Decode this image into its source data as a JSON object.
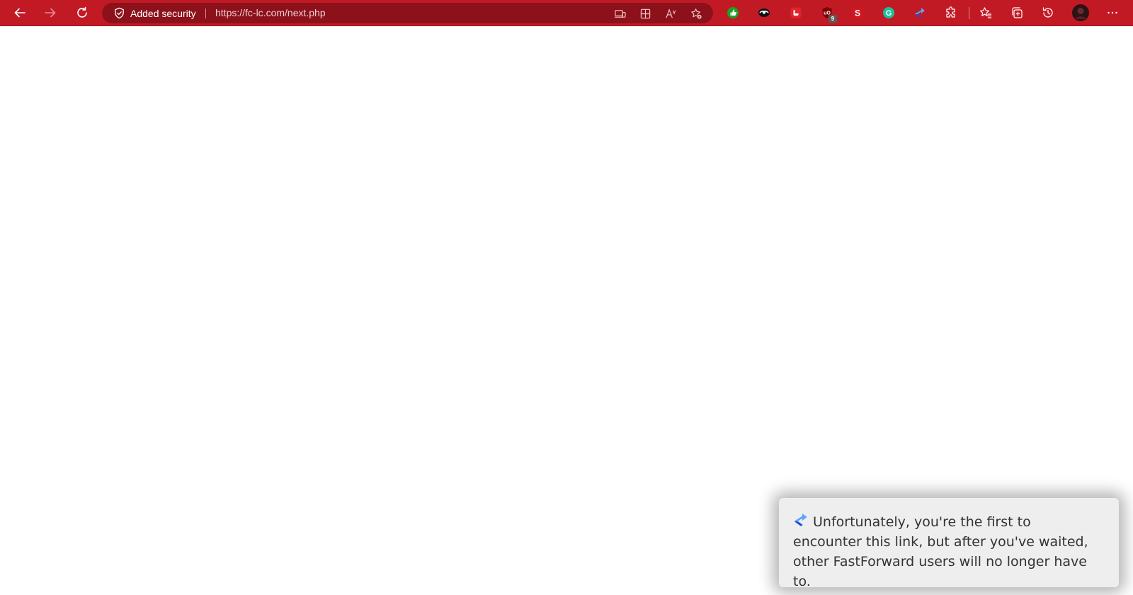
{
  "browser": {
    "security_label": "Added security",
    "url": "https://fc-lc.com/next.php",
    "accent_color": "#c21a25",
    "address_bar_color": "#8c111b",
    "nav_buttons": [
      "back-icon",
      "forward-icon",
      "refresh-icon"
    ],
    "address_icons": [
      "app-available-icon",
      "split-screen-icon",
      "read-aloud-icon",
      "add-favorite-icon"
    ],
    "extensions": [
      {
        "name": "green-thumb-extension-icon",
        "color": "#1aa322"
      },
      {
        "name": "eye-extension-icon",
        "color": "#111111"
      },
      {
        "name": "red-square-extension-icon",
        "color": "#e0242e"
      },
      {
        "name": "ublock-extension-icon",
        "color": "#800000",
        "badge": "9"
      },
      {
        "name": "s-extension-icon",
        "color": "#d3161f",
        "letter": "S"
      },
      {
        "name": "grammarly-extension-icon",
        "color": "#15c39a",
        "letter": "G"
      },
      {
        "name": "fastforward-extension-icon",
        "color": "#2a6ee8"
      },
      {
        "name": "extensions-puzzle-icon"
      }
    ],
    "right_icons": [
      "favorites-icon",
      "collections-icon",
      "history-icon",
      "profile-avatar",
      "more-options-icon"
    ]
  },
  "toast": {
    "icon": "fastforward-icon",
    "message": "Unfortunately, you're the first to encounter this link, but after you've waited, other FastForward users will no longer have to.",
    "background": "#eeeeee"
  }
}
